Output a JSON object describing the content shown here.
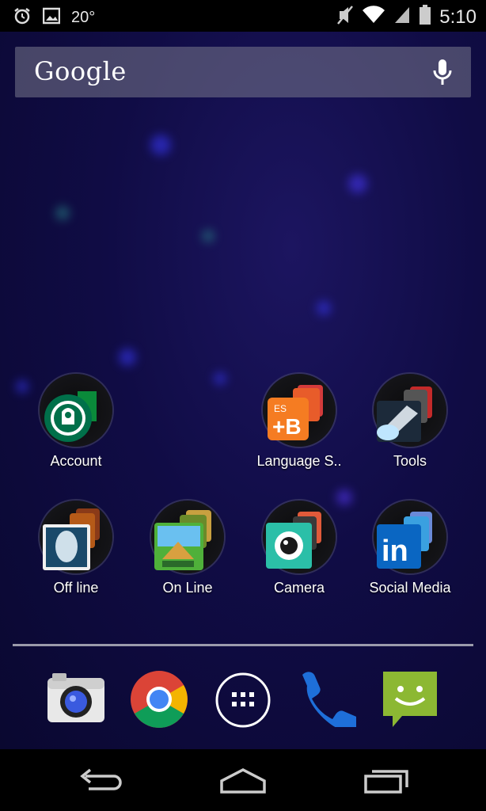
{
  "status_bar": {
    "temperature": "20°",
    "time": "5:10",
    "left_icons": [
      "alarm-icon",
      "image-icon"
    ],
    "right_icons": [
      "muted-icon",
      "wifi-icon",
      "signal-icon",
      "battery-icon"
    ]
  },
  "search": {
    "brand": "Google",
    "mic_icon": "microphone-icon"
  },
  "home_apps": [
    {
      "label": "Account",
      "icon": "starbucks-folder-icon"
    },
    {
      "label": "Language S..",
      "icon": "babbel-folder-icon"
    },
    {
      "label": "Tools",
      "icon": "flashlight-folder-icon"
    },
    {
      "label": "Off line",
      "icon": "game-folder-icon"
    },
    {
      "label": "On Line",
      "icon": "pyramid-game-folder-icon"
    },
    {
      "label": "Camera",
      "icon": "camera-folder-icon"
    },
    {
      "label": "Social Media",
      "icon": "linkedin-folder-icon"
    }
  ],
  "dock": [
    "camera-icon",
    "chrome-icon",
    "app-drawer-icon",
    "phone-icon",
    "messaging-icon"
  ],
  "nav": [
    "back-icon",
    "home-icon",
    "recents-icon"
  ],
  "colors": {
    "wallpaper": "#100c45",
    "starbucks": "#00704a",
    "babbel": "#f57c22",
    "linkedin": "#0a66c2",
    "messaging": "#8cb833"
  }
}
